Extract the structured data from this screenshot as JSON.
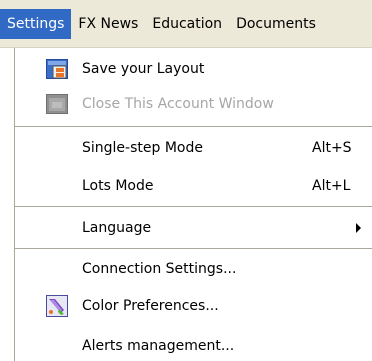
{
  "menubar": {
    "items": [
      {
        "label": "Settings",
        "active": true
      },
      {
        "label": "FX News"
      },
      {
        "label": "Education"
      },
      {
        "label": "Documents"
      }
    ]
  },
  "settings_menu": {
    "save_layout": {
      "label": "Save your Layout",
      "icon": "save-layout-icon"
    },
    "close_account": {
      "label": "Close This Account Window",
      "icon": "close-window-icon",
      "disabled": true
    },
    "single_step": {
      "label": "Single-step Mode",
      "shortcut": "Alt+S"
    },
    "lots_mode": {
      "label": "Lots Mode",
      "shortcut": "Alt+L"
    },
    "language": {
      "label": "Language",
      "submenu": true
    },
    "connection_settings": {
      "label": "Connection Settings..."
    },
    "color_preferences": {
      "label": "Color Preferences...",
      "icon": "color-palette-icon"
    },
    "alerts_management": {
      "label": "Alerts management..."
    }
  },
  "colors": {
    "menubar_bg": "#ece9d8",
    "highlight": "#316ac5",
    "disabled_text": "#a6a6a6",
    "separator": "#aca899"
  }
}
